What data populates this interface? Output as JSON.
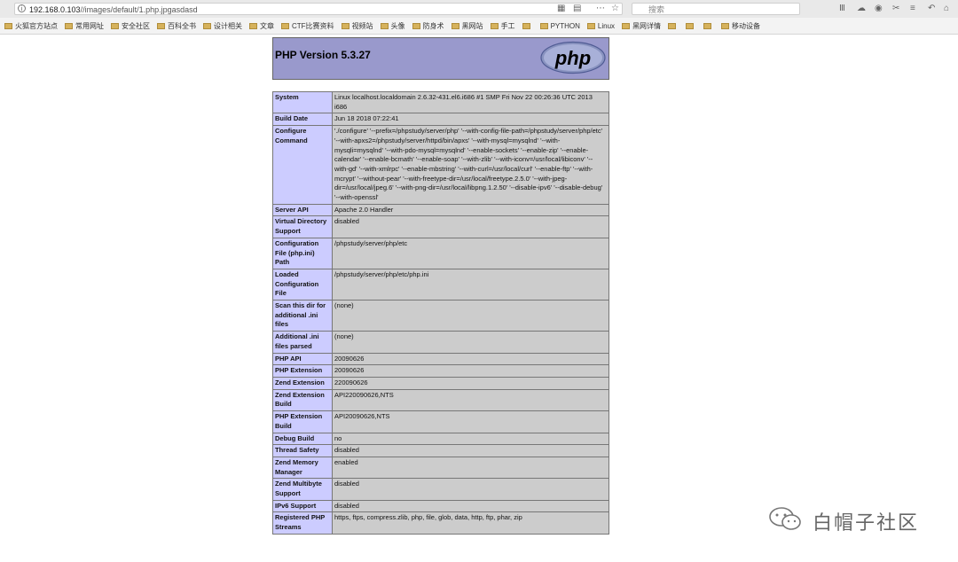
{
  "browser": {
    "url_host": "192.168.0.103",
    "url_path": "//images/default/1.php.jpgasdasd",
    "search_placeholder": "搜索",
    "bookmarks": [
      "火狐官方站点",
      "常用网址",
      "安全社区",
      "百科全书",
      "设计相关",
      "文章",
      "CTF比赛资料",
      "视频站",
      "头像",
      "防身术",
      "黑网站",
      "手工",
      "",
      "PYTHON",
      "Linux",
      "黑网详情",
      "",
      "",
      "",
      "移动设备"
    ],
    "colors": {
      "chrome": "#f3f3f3",
      "folder": "#d6b25c"
    }
  },
  "php": {
    "version_title": "PHP Version 5.3.27",
    "logo_text": "php",
    "rows": [
      {
        "key": "System",
        "value": "Linux localhost.localdomain 2.6.32-431.el6.i686 #1 SMP Fri Nov 22 00:26:36 UTC 2013 i686"
      },
      {
        "key": "Build Date",
        "value": "Jun 18 2018 07:22:41"
      },
      {
        "key": "Configure Command",
        "value": "'./configure' '--prefix=/phpstudy/server/php' '--with-config-file-path=/phpstudy/server/php/etc' '--with-apxs2=/phpstudy/server/httpd/bin/apxs' '--with-mysql=mysqlnd' '--with-mysqli=mysqlnd' '--with-pdo-mysql=mysqlnd' '--enable-sockets' '--enable-zip' '--enable-calendar' '--enable-bcmath' '--enable-soap' '--with-zlib' '--with-iconv=/usr/local/libiconv' '--with-gd' '--with-xmlrpc' '--enable-mbstring' '--with-curl=/usr/local/curl' '--enable-ftp' '--with-mcrypt' '--without-pear' '--with-freetype-dir=/usr/local/freetype.2.5.0' '--with-jpeg-dir=/usr/local/jpeg.6' '--with-png-dir=/usr/local/libpng.1.2.50' '--disable-ipv6' '--disable-debug' '--with-openssl'"
      },
      {
        "key": "Server API",
        "value": "Apache 2.0 Handler"
      },
      {
        "key": "Virtual Directory Support",
        "value": "disabled"
      },
      {
        "key": "Configuration File (php.ini) Path",
        "value": "/phpstudy/server/php/etc"
      },
      {
        "key": "Loaded Configuration File",
        "value": "/phpstudy/server/php/etc/php.ini"
      },
      {
        "key": "Scan this dir for additional .ini files",
        "value": "(none)"
      },
      {
        "key": "Additional .ini files parsed",
        "value": "(none)"
      },
      {
        "key": "PHP API",
        "value": "20090626"
      },
      {
        "key": "PHP Extension",
        "value": "20090626"
      },
      {
        "key": "Zend Extension",
        "value": "220090626"
      },
      {
        "key": "Zend Extension Build",
        "value": "API220090626,NTS"
      },
      {
        "key": "PHP Extension Build",
        "value": "API20090626,NTS"
      },
      {
        "key": "Debug Build",
        "value": "no"
      },
      {
        "key": "Thread Safety",
        "value": "disabled"
      },
      {
        "key": "Zend Memory Manager",
        "value": "enabled"
      },
      {
        "key": "Zend Multibyte Support",
        "value": "disabled"
      },
      {
        "key": "IPv6 Support",
        "value": "disabled"
      },
      {
        "key": "Registered PHP Streams",
        "value": "https, ftps, compress.zlib, php, file, glob, data, http, ftp, phar, zip"
      }
    ],
    "colors": {
      "header": "#9999cc",
      "key_cell": "#ccccff",
      "value_cell": "#cccccc"
    }
  },
  "watermark": {
    "text": "白帽子社区"
  }
}
